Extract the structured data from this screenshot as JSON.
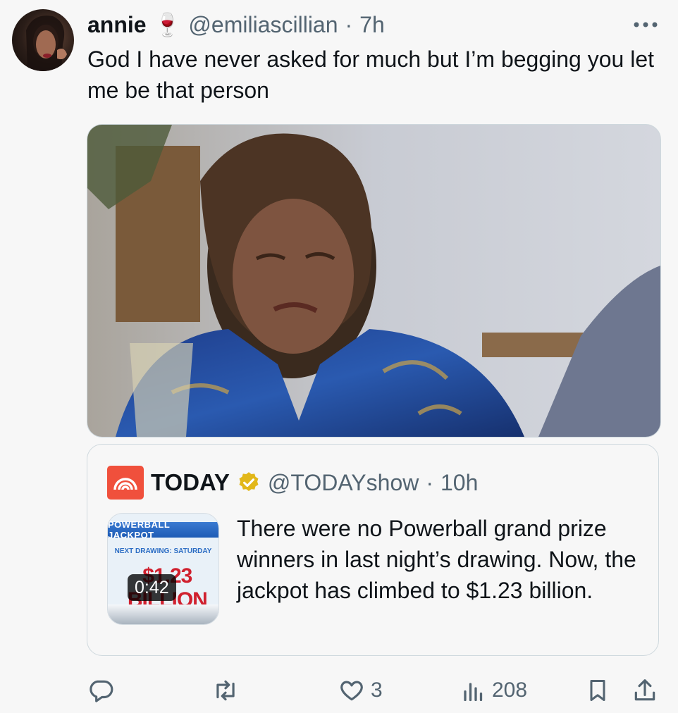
{
  "tweet": {
    "author_name": "annie",
    "author_emoji": "🍷",
    "handle": "@emiliascillian",
    "separator": "·",
    "time": "7h",
    "text": "God I have never asked for much but I’m begging you let me be that person"
  },
  "quoted_tweet": {
    "author_name": "TODAY",
    "handle": "@TODAYshow",
    "separator": "·",
    "time": "10h",
    "text": "There were no Powerball grand prize winners in last night’s drawing. Now, the jackpot has climbed to $1.23 billion.",
    "video_duration": "0:42",
    "thumbnail": {
      "banner": "POWERBALL JACKPOT",
      "next_drawing": "NEXT DRAWING: SATURDAY",
      "amount": "$1.23 BILLION"
    }
  },
  "actions": {
    "reply_count": "",
    "retweet_count": "",
    "like_count": "3",
    "views_count": "208"
  },
  "colors": {
    "secondary_text": "#536471",
    "verified_gold": "#e2b719",
    "today_brand": "#f0503c",
    "background": "#f7f7f7"
  },
  "icons": [
    "more-icon",
    "reply-icon",
    "retweet-icon",
    "like-icon",
    "views-icon",
    "bookmark-icon",
    "share-icon",
    "verified-badge-icon",
    "today-logo-icon"
  ]
}
